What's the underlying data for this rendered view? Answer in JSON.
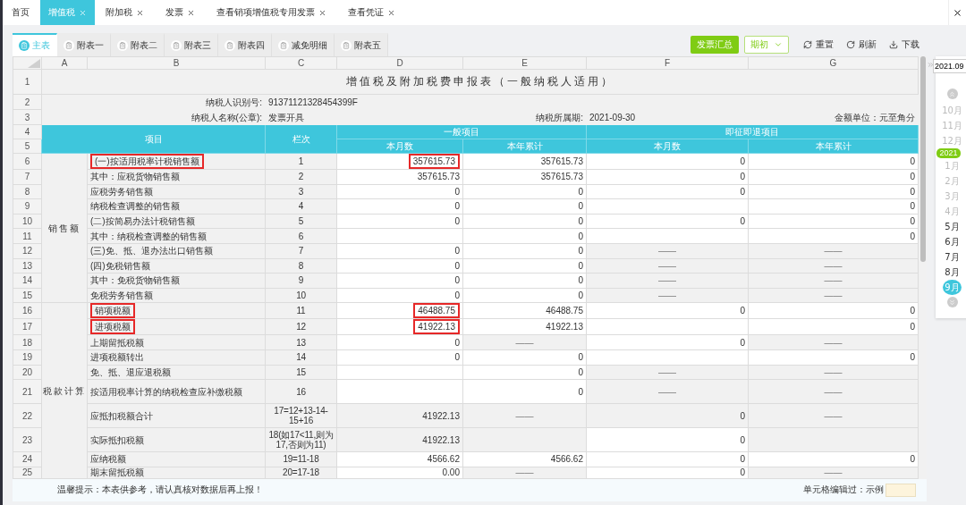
{
  "tabs": [
    {
      "label": "首页",
      "selected": false,
      "closable": false
    },
    {
      "label": "增值税",
      "selected": true,
      "closable": true
    },
    {
      "label": "附加税",
      "selected": false,
      "closable": true
    },
    {
      "label": "发票",
      "selected": false,
      "closable": true
    },
    {
      "label": "查看销项增值税专用发票",
      "selected": false,
      "closable": true
    },
    {
      "label": "查看凭证",
      "selected": false,
      "closable": true
    }
  ],
  "sheet_tabs": [
    {
      "label": "主表",
      "selected": true
    },
    {
      "label": "附表一",
      "selected": false
    },
    {
      "label": "附表二",
      "selected": false
    },
    {
      "label": "附表三",
      "selected": false
    },
    {
      "label": "附表四",
      "selected": false
    },
    {
      "label": "减免明细",
      "selected": false
    },
    {
      "label": "附表五",
      "selected": false
    }
  ],
  "toolbar": {
    "summary_button": "发票汇总",
    "period_select": "期初",
    "actions": [
      {
        "kind": "reset",
        "label": "重置"
      },
      {
        "kind": "refresh",
        "label": "刷新"
      },
      {
        "kind": "download",
        "label": "下载"
      }
    ]
  },
  "sheet": {
    "column_letters": [
      "A",
      "B",
      "C",
      "D",
      "E",
      "F",
      "G"
    ],
    "top_row_numbers": [
      "1",
      "2",
      "3",
      "4",
      "5"
    ],
    "title": "增值税及附加税费申报表（一般纳税人适用）",
    "taxpayer_id_label": "纳税人识别号:",
    "taxpayer_id": "91371121328454399F",
    "taxpayer_name_label": "纳税人名称(公章):",
    "taxpayer_name": "发票开具",
    "period_label": "纳税所属期:",
    "period": "2021-09-30",
    "unit_label": "金额单位：元至角分",
    "header": {
      "item": "项目",
      "line": "栏次",
      "general": "一般项目",
      "refund": "即征即退项目",
      "columns": [
        "本月数",
        "本年累计",
        "本月数",
        "本年累计"
      ]
    },
    "groups": [
      {
        "label": "销售额",
        "rows": [
          {
            "number": "6",
            "label": "(一)按适用税率计税销售额",
            "label_marked": true,
            "line": "1",
            "cells": [
              {
                "value": "357615.73",
                "locked": false,
                "marked": true
              },
              {
                "value": "357615.73",
                "locked": false,
                "marked": false
              },
              {
                "value": "0",
                "locked": false,
                "marked": false
              },
              {
                "value": "0",
                "locked": false,
                "marked": false
              }
            ]
          },
          {
            "number": "7",
            "label": "其中：应税货物销售额",
            "label_marked": false,
            "line": "2",
            "cells": [
              {
                "value": "357615.73",
                "locked": false,
                "marked": false
              },
              {
                "value": "357615.73",
                "locked": false,
                "marked": false
              },
              {
                "value": "0",
                "locked": false,
                "marked": false
              },
              {
                "value": "0",
                "locked": false,
                "marked": false
              }
            ]
          },
          {
            "number": "8",
            "label": "应税劳务销售额",
            "label_marked": false,
            "line": "3",
            "cells": [
              {
                "value": "0",
                "locked": false,
                "marked": false
              },
              {
                "value": "0",
                "locked": false,
                "marked": false
              },
              {
                "value": "0",
                "locked": false,
                "marked": false
              },
              {
                "value": "0",
                "locked": false,
                "marked": false
              }
            ]
          },
          {
            "number": "9",
            "label": "纳税检查调整的销售额",
            "label_marked": false,
            "line": "4",
            "cells": [
              {
                "value": "0",
                "locked": false,
                "marked": false
              },
              {
                "value": "0",
                "locked": false,
                "marked": false
              },
              {
                "locked": false,
                "marked": false
              },
              {
                "value": "0",
                "locked": false,
                "marked": false
              }
            ]
          },
          {
            "number": "10",
            "label": "(二)按简易办法计税销售额",
            "label_marked": false,
            "line": "5",
            "cells": [
              {
                "value": "0",
                "locked": false,
                "marked": false
              },
              {
                "value": "0",
                "locked": false,
                "marked": false
              },
              {
                "value": "0",
                "locked": false,
                "marked": false
              },
              {
                "value": "0",
                "locked": false,
                "marked": false
              }
            ]
          },
          {
            "number": "11",
            "label": "其中：纳税检查调整的销售额",
            "label_marked": false,
            "line": "6",
            "cells": [
              {
                "locked": false,
                "marked": false
              },
              {
                "value": "0",
                "locked": false,
                "marked": false
              },
              {
                "locked": false,
                "marked": false
              },
              {
                "value": "0",
                "locked": false,
                "marked": false
              }
            ]
          },
          {
            "number": "12",
            "label": "(三)免、抵、退办法出口销售额",
            "label_marked": false,
            "line": "7",
            "cells": [
              {
                "value": "0",
                "locked": false,
                "marked": false
              },
              {
                "value": "0",
                "locked": false,
                "marked": false
              },
              {
                "value": "——",
                "locked": true,
                "marked": false
              },
              {
                "value": "——",
                "locked": true,
                "marked": false
              }
            ]
          },
          {
            "number": "13",
            "label": "(四)免税销售额",
            "label_marked": false,
            "line": "8",
            "cells": [
              {
                "value": "0",
                "locked": false,
                "marked": false
              },
              {
                "value": "0",
                "locked": false,
                "marked": false
              },
              {
                "value": "——",
                "locked": true,
                "marked": false
              },
              {
                "value": "——",
                "locked": true,
                "marked": false
              }
            ]
          },
          {
            "number": "14",
            "label": "其中：免税货物销售额",
            "label_marked": false,
            "line": "9",
            "cells": [
              {
                "value": "0",
                "locked": false,
                "marked": false
              },
              {
                "value": "0",
                "locked": false,
                "marked": false
              },
              {
                "value": "——",
                "locked": true,
                "marked": false
              },
              {
                "value": "——",
                "locked": true,
                "marked": false
              }
            ]
          },
          {
            "number": "15",
            "label": "免税劳务销售额",
            "label_marked": false,
            "line": "10",
            "cells": [
              {
                "value": "0",
                "locked": false,
                "marked": false
              },
              {
                "value": "0",
                "locked": false,
                "marked": false
              },
              {
                "value": "——",
                "locked": true,
                "marked": false
              },
              {
                "value": "——",
                "locked": true,
                "marked": false
              }
            ]
          }
        ]
      },
      {
        "label": "税款计算",
        "rows": [
          {
            "number": "16",
            "label": "销项税额",
            "label_marked": true,
            "line": "11",
            "cells": [
              {
                "value": "46488.75",
                "locked": false,
                "marked": true
              },
              {
                "value": "46488.75",
                "locked": false,
                "marked": false
              },
              {
                "value": "0",
                "locked": false,
                "marked": false
              },
              {
                "value": "0",
                "locked": false,
                "marked": false
              }
            ]
          },
          {
            "number": "17",
            "label": "进项税额",
            "label_marked": true,
            "line": "12",
            "cells": [
              {
                "value": "41922.13",
                "locked": false,
                "marked": true
              },
              {
                "value": "41922.13",
                "locked": false,
                "marked": false
              },
              {
                "locked": false,
                "marked": false
              },
              {
                "value": "0",
                "locked": false,
                "marked": false
              }
            ]
          },
          {
            "number": "18",
            "label": "上期留抵税额",
            "label_marked": false,
            "line": "13",
            "cells": [
              {
                "value": "0",
                "locked": false,
                "marked": false
              },
              {
                "value": "——",
                "locked": true,
                "marked": false
              },
              {
                "value": "0",
                "locked": false,
                "marked": false
              },
              {
                "value": "——",
                "locked": true,
                "marked": false
              }
            ]
          },
          {
            "number": "19",
            "label": "进项税额转出",
            "label_marked": false,
            "line": "14",
            "cells": [
              {
                "value": "0",
                "locked": false,
                "marked": false
              },
              {
                "value": "0",
                "locked": false,
                "marked": false
              },
              {
                "locked": false,
                "marked": false
              },
              {
                "value": "0",
                "locked": false,
                "marked": false
              }
            ]
          },
          {
            "number": "20",
            "label": "免、抵、退应退税额",
            "label_marked": false,
            "line": "15",
            "cells": [
              {
                "locked": false,
                "marked": false
              },
              {
                "value": "0",
                "locked": false,
                "marked": false
              },
              {
                "value": "——",
                "locked": true,
                "marked": false
              },
              {
                "value": "——",
                "locked": true,
                "marked": false
              }
            ]
          },
          {
            "number": "21",
            "label": "按适用税率计算的纳税检查应补缴税额",
            "label_marked": false,
            "line": "16",
            "tall": true,
            "cells": [
              {
                "locked": false,
                "marked": false
              },
              {
                "value": "0",
                "locked": false,
                "marked": false
              },
              {
                "value": "——",
                "locked": true,
                "marked": false
              },
              {
                "value": "——",
                "locked": true,
                "marked": false
              }
            ]
          },
          {
            "number": "22",
            "label": "应抵扣税额合计",
            "label_marked": false,
            "line": "17=12+13-14-15+16",
            "tall": true,
            "cells": [
              {
                "value": "41922.13",
                "locked": true,
                "marked": false
              },
              {
                "value": "——",
                "locked": true,
                "marked": false
              },
              {
                "value": "0",
                "locked": true,
                "marked": false
              },
              {
                "value": "——",
                "locked": true,
                "marked": false
              }
            ]
          },
          {
            "number": "23",
            "label": "实际抵扣税额",
            "label_marked": false,
            "line": "18(如17<11,则为17,否则为11)",
            "tall": true,
            "cells": [
              {
                "value": "41922.13",
                "locked": true,
                "marked": false
              },
              {
                "locked": true,
                "marked": false
              },
              {
                "value": "0",
                "locked": false,
                "marked": false
              },
              {
                "locked": true,
                "marked": false
              }
            ]
          },
          {
            "number": "24",
            "label": "应纳税额",
            "label_marked": false,
            "line": "19=11-18",
            "cells": [
              {
                "value": "4566.62",
                "locked": false,
                "marked": false
              },
              {
                "value": "4566.62",
                "locked": false,
                "marked": false
              },
              {
                "value": "0",
                "locked": false,
                "marked": false
              },
              {
                "value": "0",
                "locked": false,
                "marked": false
              }
            ]
          },
          {
            "number": "25",
            "label": "期末留抵税额",
            "label_marked": false,
            "line": "20=17-18",
            "cut": true,
            "cells": [
              {
                "value": "0.00",
                "locked": false,
                "marked": false
              },
              {
                "value": "——",
                "locked": true,
                "marked": false
              },
              {
                "value": "0",
                "locked": false,
                "marked": false
              },
              {
                "value": "——",
                "locked": true,
                "marked": false
              }
            ]
          }
        ]
      }
    ]
  },
  "footer": {
    "hint": "温馨提示：本表供参考，请认真核对数据后再上报！",
    "legend_label": "单元格编辑过：示例"
  },
  "calendar": {
    "date": "2021.09",
    "months": [
      {
        "label": "10月",
        "disabled": true,
        "selected": false
      },
      {
        "label": "11月",
        "disabled": true,
        "selected": false
      },
      {
        "label": "12月",
        "disabled": true,
        "selected": false
      },
      {
        "label": "1月",
        "disabled": true,
        "selected": false,
        "year": "2021"
      },
      {
        "label": "2月",
        "disabled": true,
        "selected": false
      },
      {
        "label": "3月",
        "disabled": true,
        "selected": false
      },
      {
        "label": "4月",
        "disabled": true,
        "selected": false
      },
      {
        "label": "5月",
        "disabled": false,
        "selected": false
      },
      {
        "label": "6月",
        "disabled": false,
        "selected": false
      },
      {
        "label": "7月",
        "disabled": false,
        "selected": false
      },
      {
        "label": "8月",
        "disabled": false,
        "selected": false
      },
      {
        "label": "9月",
        "disabled": false,
        "selected": true
      }
    ]
  }
}
